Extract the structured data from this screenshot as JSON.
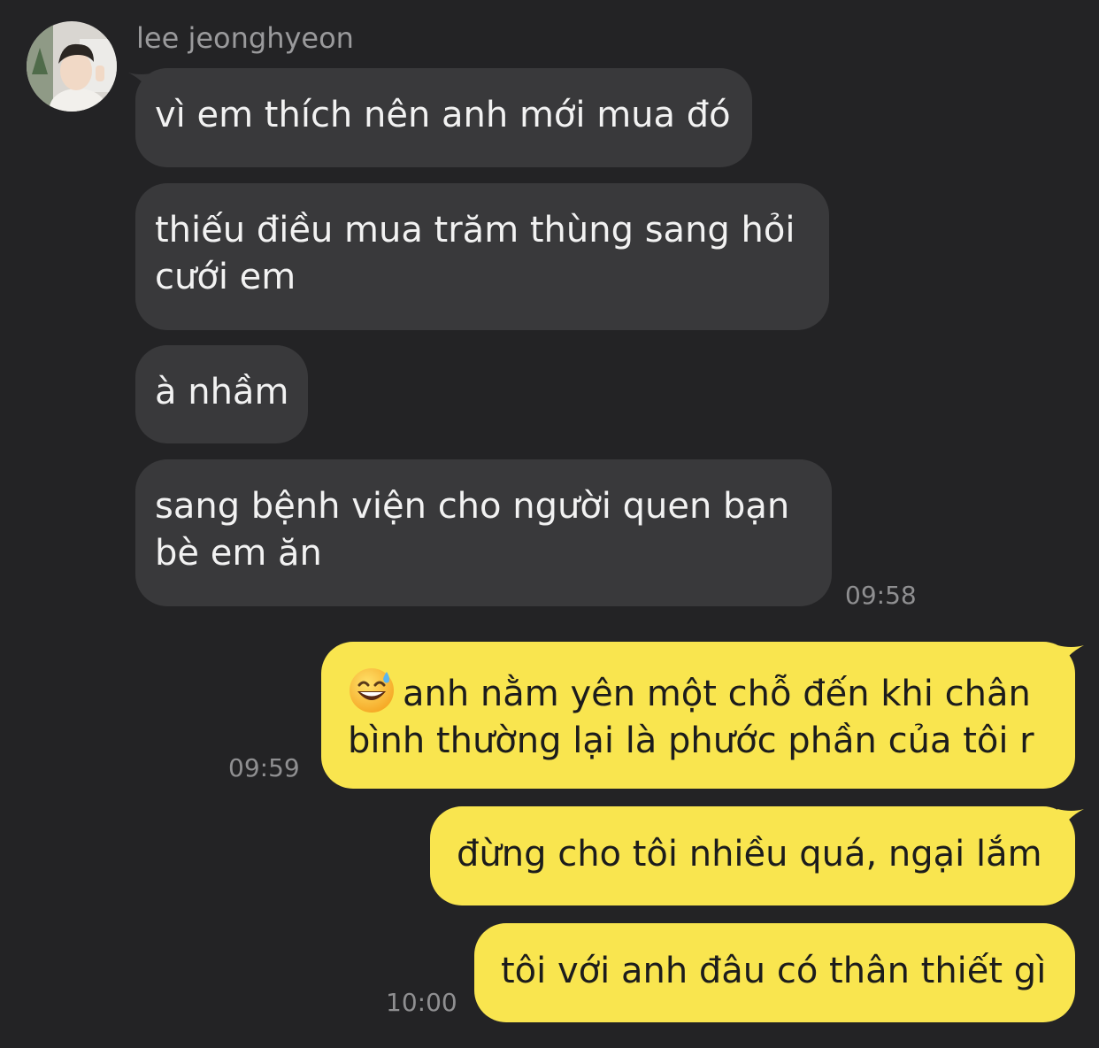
{
  "chat": {
    "sender_name": "lee jeonghyeon",
    "colors": {
      "background": "#232325",
      "incoming_bubble": "#39393b",
      "outgoing_bubble": "#f9e54f",
      "timestamp": "#8f8f91"
    },
    "incoming": [
      {
        "lines": [
          "vì em thích nên anh mới mua đó"
        ]
      },
      {
        "lines": [
          "thiếu điều mua trăm thùng sang hỏi",
          "cưới em"
        ]
      },
      {
        "lines": [
          "à nhầm"
        ]
      },
      {
        "lines": [
          "sang bệnh viện cho người quen bạn",
          "bè em ăn"
        ],
        "time": "09:58"
      }
    ],
    "outgoing": [
      {
        "emoji": "grinning-face-with-sweat-icon",
        "lines": [
          "anh nằm yên một chỗ đến khi chân",
          "bình thường lại là phước phần của tôi r"
        ],
        "time": "09:59"
      },
      {
        "lines": [
          "đừng cho tôi nhiều quá, ngại lắm"
        ]
      },
      {
        "lines": [
          "tôi với anh đâu có thân thiết gì"
        ],
        "time": "10:00"
      }
    ]
  }
}
